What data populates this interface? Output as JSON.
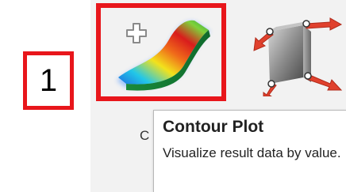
{
  "callout": {
    "number": "1",
    "color": "#e8161b"
  },
  "toolbar": {
    "contour_tool": {
      "icon": "contour-plot-icon",
      "badge_icon": "plus-icon",
      "highlight_color": "#e8161b"
    },
    "vector_tool": {
      "icon": "vector-plot-icon"
    },
    "clipped_label": "C"
  },
  "tooltip": {
    "title": "Contour Plot",
    "description": "Visualize result data by value."
  }
}
